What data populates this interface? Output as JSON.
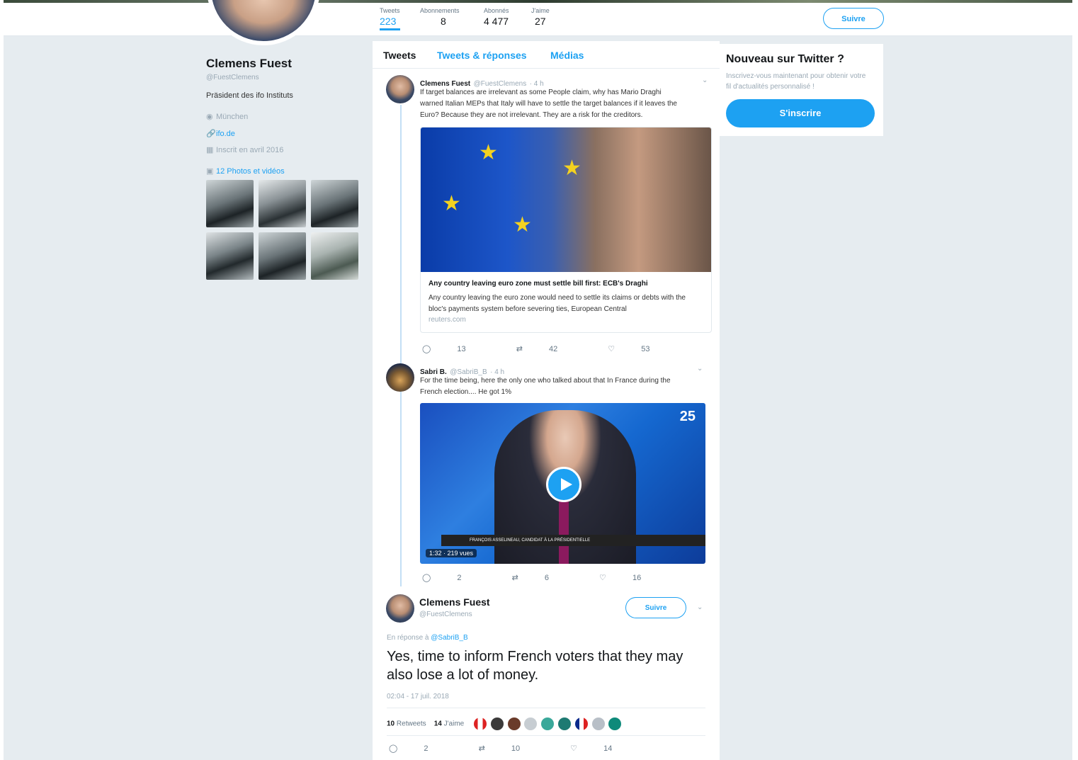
{
  "profile_nav": {
    "stats": [
      {
        "label": "Tweets",
        "value": "223"
      },
      {
        "label": "Abonnements",
        "value": "8"
      },
      {
        "label": "Abonnés",
        "value": "4 477"
      },
      {
        "label": "J'aime",
        "value": "27"
      }
    ],
    "follow_label": "Suivre"
  },
  "profile": {
    "name": "Clemens Fuest",
    "handle": "@FuestClemens",
    "bio": "Präsident des ifo Instituts",
    "location": "München",
    "website": "ifo.de",
    "joined": "Inscrit en avril 2016",
    "media_link": "12 Photos et vidéos"
  },
  "tabs": [
    "Tweets",
    "Tweets & réponses",
    "Médias"
  ],
  "tweet1": {
    "name": "Clemens Fuest",
    "handle": "@FuestClemens",
    "time": "· 4 h",
    "text_lines": [
      "If target balances are irrelevant as some People claim, why has Mario Draghi",
      "warned Italian MEPs that Italy will have to settle the target balances if it leaves the",
      "Euro? Because they are not irrelevant. They are a risk for the creditors."
    ],
    "card": {
      "title": "Any country leaving euro zone must settle bill first: ECB's Draghi",
      "desc": "Any country leaving the euro zone would need to settle its claims or debts with the bloc's payments system before severing ties, European Central",
      "domain": "reuters.com"
    },
    "actions": {
      "replies": "13",
      "retweets": "42",
      "likes": "53"
    }
  },
  "tweet2": {
    "name": "Sabri B.",
    "handle": "@SabriB_B",
    "time": "· 4 h",
    "text_lines": [
      "For the time being, here the only one who talked about that In France during the",
      "French election.... He got 1%"
    ],
    "video": {
      "duration_views": "1:32 · 219 vues",
      "lower_third": "FRANÇOIS ASSELINEAU, CANDIDAT À LA PRÉSIDENTIELLE",
      "channel": "25"
    },
    "actions": {
      "replies": "2",
      "retweets": "6",
      "likes": "16"
    }
  },
  "focus_tweet": {
    "name": "Clemens Fuest",
    "handle": "@FuestClemens",
    "follow_label": "Suivre",
    "reply_prefix": "En réponse à",
    "reply_handle": "@SabriB_B",
    "text": "Yes, time to inform French voters that they may also lose a lot of money.",
    "timestamp": "02:04 - 17 juil. 2018",
    "retweets_count": "10",
    "retweets_label": "Retweets",
    "likes_count": "14",
    "likes_label": "J'aime",
    "actions": {
      "replies": "2",
      "retweets": "10",
      "likes": "14"
    }
  },
  "sidebar_right": {
    "title": "Nouveau sur Twitter ?",
    "subtitle": "Inscrivez-vous maintenant pour obtenir votre fil d'actualités personnalisé !",
    "signup_label": "S'inscrire"
  },
  "colors": {
    "accent": "#1da1f2",
    "background": "#e6ecf0"
  }
}
